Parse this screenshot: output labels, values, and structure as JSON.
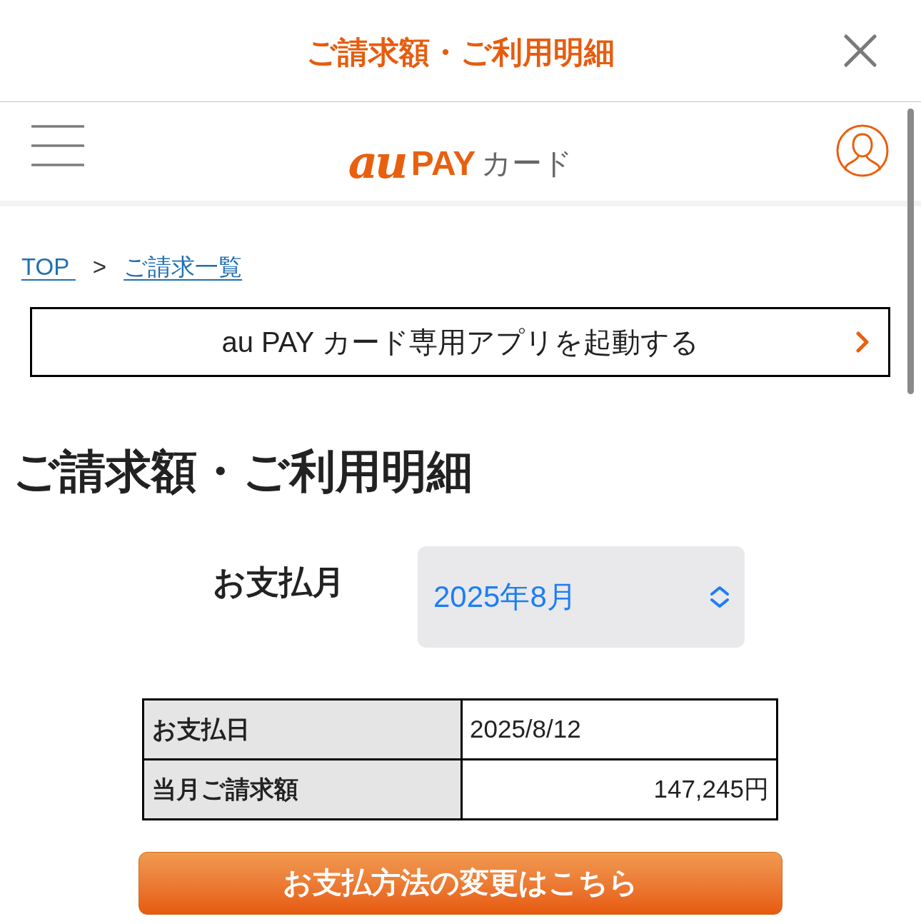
{
  "modal": {
    "title": "ご請求額・ご利用明細"
  },
  "header": {
    "logo": {
      "mark": "au",
      "brand": "PAY",
      "suffix": "カード"
    }
  },
  "breadcrumb": [
    {
      "kind": "link",
      "label": "TOP "
    },
    {
      "kind": "separator",
      "label": ">"
    },
    {
      "kind": "link",
      "label": "ご請求一覧"
    }
  ],
  "app_button": {
    "label": "au PAY カード専用アプリを起動する"
  },
  "heading": "ご請求額・ご利用明細",
  "payment_month": {
    "label": "お支払月",
    "value": "2025年8月"
  },
  "summary_table": {
    "rows": [
      {
        "kind": "date",
        "label": "お支払日",
        "value": "2025/8/12"
      },
      {
        "kind": "amount",
        "label": "当月ご請求額",
        "value": "147,245円"
      }
    ]
  },
  "change_button": {
    "label": "お支払方法の変更はこちら"
  }
}
